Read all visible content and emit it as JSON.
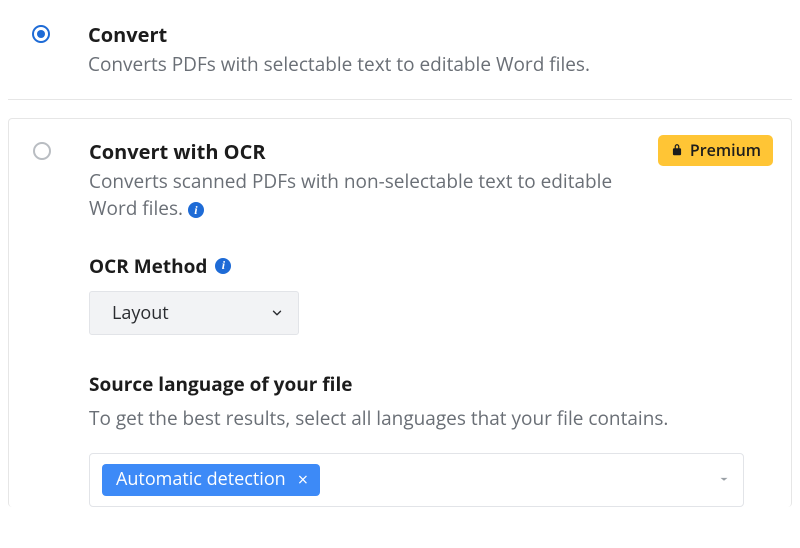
{
  "options": {
    "convert": {
      "title": "Convert",
      "desc": "Converts PDFs with selectable text to editable Word files.",
      "selected": true
    },
    "convert_ocr": {
      "title": "Convert with OCR",
      "desc": "Converts scanned PDFs with non-selectable text to editable Word files.",
      "selected": false,
      "premium_label": "Premium"
    }
  },
  "ocr_method": {
    "label": "OCR Method",
    "selected": "Layout"
  },
  "source_language": {
    "label": "Source language of your file",
    "help": "To get the best results, select all languages that your file contains.",
    "tags": [
      "Automatic detection"
    ]
  },
  "glyphs": {
    "info": "i",
    "close": "×"
  }
}
